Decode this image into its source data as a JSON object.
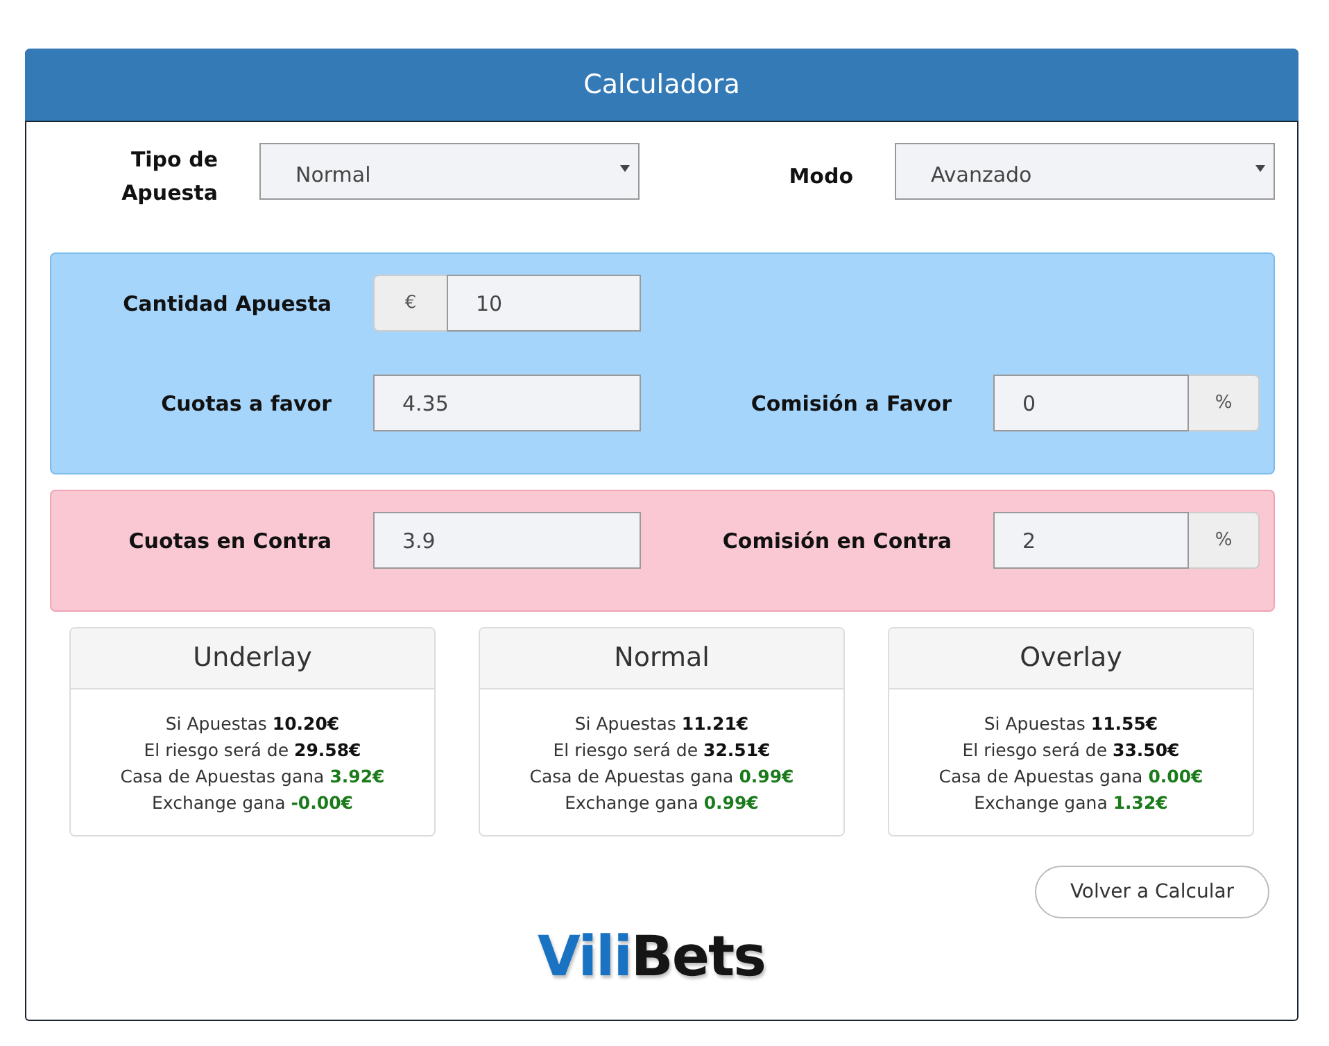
{
  "panel": {
    "title": "Calculadora"
  },
  "settings": [
    {
      "label": "Tipo de Apuesta",
      "value": "Normal"
    },
    {
      "label": "Modo",
      "value": "Avanzado"
    }
  ],
  "sections": [
    {
      "kind": "back",
      "rows": [
        [
          {
            "label": "Cantidad Apuesta",
            "value": "10",
            "prefix": "€"
          }
        ],
        [
          {
            "label": "Cuotas a favor",
            "value": "4.35"
          },
          {
            "label": "Comisión a Favor",
            "value": "0",
            "suffix": "%"
          }
        ]
      ]
    },
    {
      "kind": "lay",
      "rows": [
        [
          {
            "label": "Cuotas en Contra",
            "value": "3.9"
          },
          {
            "label": "Comisión en Contra",
            "value": "2",
            "suffix": "%"
          }
        ]
      ]
    }
  ],
  "results": [
    {
      "title": "Underlay",
      "lines": [
        {
          "label": "Si Apuestas",
          "value": "10.20€",
          "kind": "amount"
        },
        {
          "label": "El riesgo será de",
          "value": "29.58€",
          "kind": "amount"
        },
        {
          "label": "Casa de Apuestas gana",
          "value": "3.92€",
          "kind": "profit"
        },
        {
          "label": "Exchange gana",
          "value": "-0.00€",
          "kind": "profit"
        }
      ]
    },
    {
      "title": "Normal",
      "lines": [
        {
          "label": "Si Apuestas",
          "value": "11.21€",
          "kind": "amount"
        },
        {
          "label": "El riesgo será de",
          "value": "32.51€",
          "kind": "amount"
        },
        {
          "label": "Casa de Apuestas gana",
          "value": "0.99€",
          "kind": "profit"
        },
        {
          "label": "Exchange gana",
          "value": "0.99€",
          "kind": "profit"
        }
      ]
    },
    {
      "title": "Overlay",
      "lines": [
        {
          "label": "Si Apuestas",
          "value": "11.55€",
          "kind": "amount"
        },
        {
          "label": "El riesgo será de",
          "value": "33.50€",
          "kind": "amount"
        },
        {
          "label": "Casa de Apuestas gana",
          "value": "0.00€",
          "kind": "profit"
        },
        {
          "label": "Exchange gana",
          "value": "1.32€",
          "kind": "profit"
        }
      ]
    }
  ],
  "button": {
    "label": "Volver a Calcular"
  },
  "logo": [
    {
      "text": "Vili",
      "color": "#1a72c2"
    },
    {
      "text": "Bets",
      "color": "#151515"
    }
  ]
}
